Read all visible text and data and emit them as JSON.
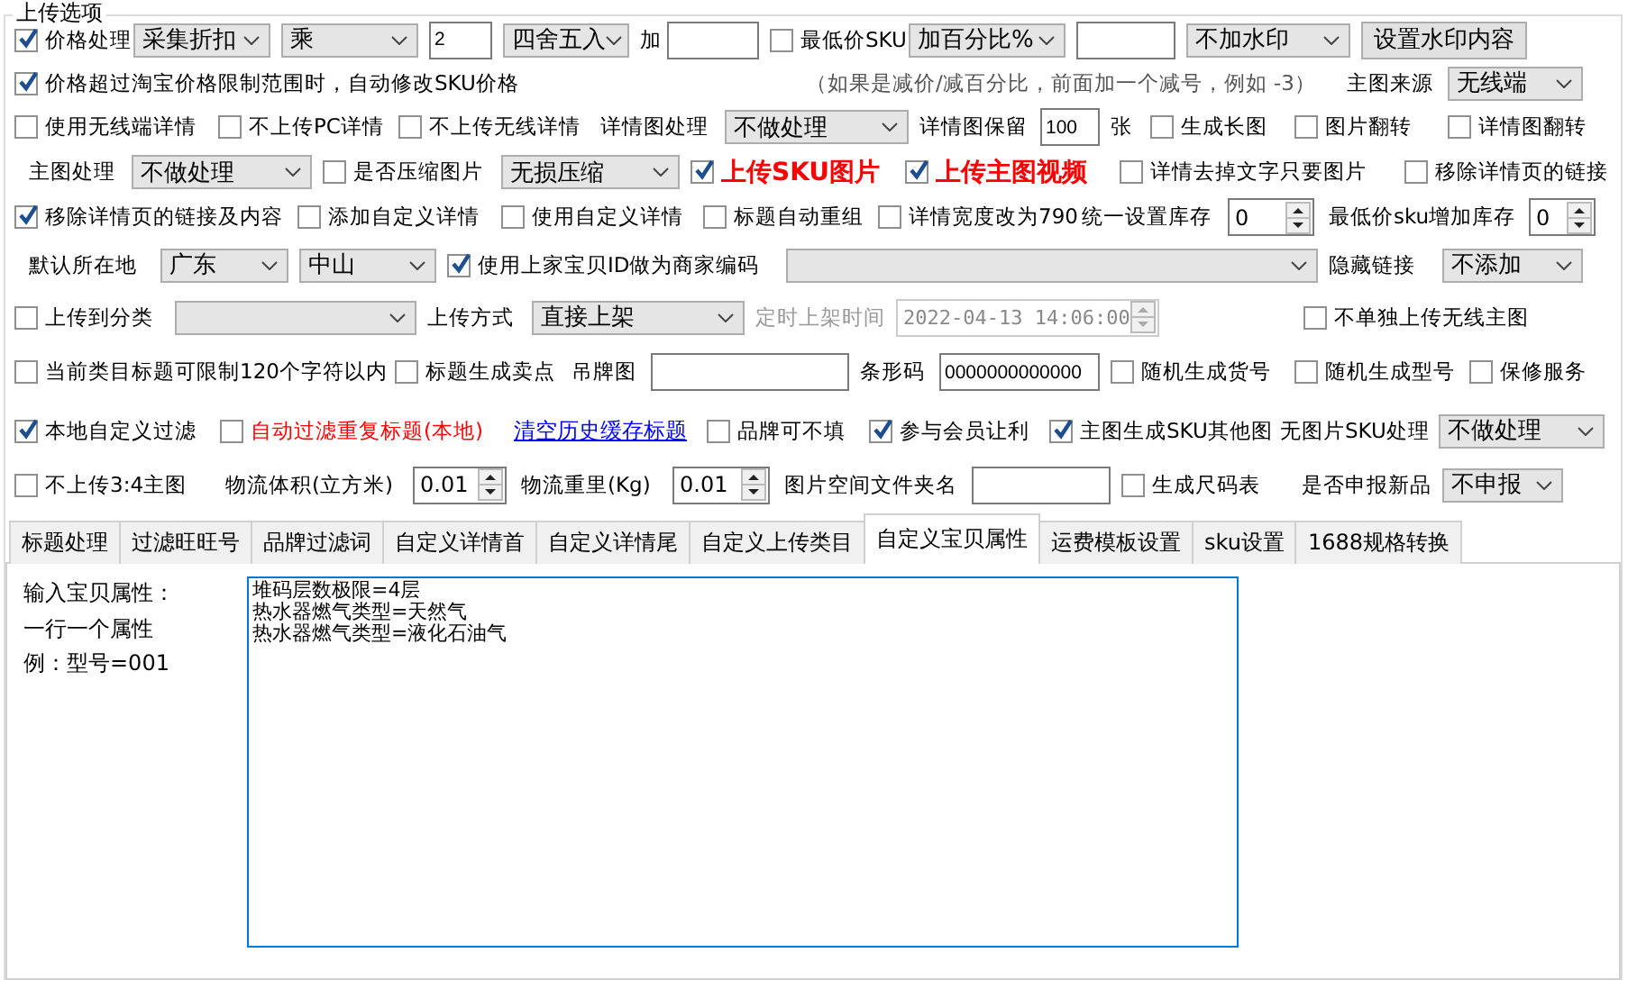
{
  "group_title": "上传选项",
  "option_rows": [
    [
      {
        "kind": "check",
        "label": "价格处理",
        "checked": true
      },
      {
        "kind": "select",
        "value": "采集折扣"
      },
      {
        "kind": "select",
        "value": "乘"
      },
      {
        "kind": "input",
        "value": "2"
      },
      {
        "kind": "select",
        "value": "四舍五入"
      },
      {
        "kind": "label",
        "text": "加"
      },
      {
        "kind": "input"
      },
      {
        "kind": "check",
        "label": "最低价SKU",
        "checked": false
      },
      {
        "kind": "select",
        "value": "加百分比%"
      },
      {
        "kind": "input"
      },
      {
        "kind": "select",
        "value": "不加水印"
      },
      {
        "kind": "button",
        "text": "设置水印内容"
      }
    ],
    [
      {
        "kind": "check",
        "label": "价格超过淘宝价格限制范围时，自动修改SKU价格",
        "checked": true
      },
      {
        "kind": "note",
        "text": "（如果是减价/减百分比，前面加一个减号，例如 -3）"
      },
      {
        "kind": "label",
        "text": "主图来源"
      },
      {
        "kind": "select",
        "value": "无线端"
      }
    ],
    [
      {
        "kind": "check",
        "label": "使用无线端详情",
        "checked": false
      },
      {
        "kind": "check",
        "label": "不上传PC详情",
        "checked": false
      },
      {
        "kind": "check",
        "label": "不上传无线详情",
        "checked": false
      },
      {
        "kind": "label",
        "text": "详情图处理"
      },
      {
        "kind": "select",
        "value": "不做处理"
      },
      {
        "kind": "label",
        "text": "详情图保留"
      },
      {
        "kind": "input",
        "value": "100"
      },
      {
        "kind": "label",
        "text": "张"
      },
      {
        "kind": "check",
        "label": "生成长图",
        "checked": false
      },
      {
        "kind": "check",
        "label": "图片翻转",
        "checked": false
      },
      {
        "kind": "check",
        "label": "详情图翻转",
        "checked": false
      }
    ],
    [
      {
        "kind": "label",
        "text": "主图处理"
      },
      {
        "kind": "select",
        "value": "不做处理"
      },
      {
        "kind": "check",
        "label": "是否压缩图片",
        "checked": false
      },
      {
        "kind": "select",
        "value": "无损压缩"
      },
      {
        "kind": "check",
        "label": "上传SKU图片",
        "checked": true,
        "color": "#ff0000",
        "bold": true
      },
      {
        "kind": "check",
        "label": "上传主图视频",
        "checked": true,
        "color": "#ff0000",
        "bold": true
      },
      {
        "kind": "check",
        "label": "详情去掉文字只要图片",
        "checked": false
      },
      {
        "kind": "check",
        "label": "移除详情页的链接",
        "checked": false
      }
    ],
    [
      {
        "kind": "check",
        "label": "移除详情页的链接及内容",
        "checked": true
      },
      {
        "kind": "check",
        "label": "添加自定义详情",
        "checked": false
      },
      {
        "kind": "check",
        "label": "使用自定义详情",
        "checked": false
      },
      {
        "kind": "check",
        "label": "标题自动重组",
        "checked": false
      },
      {
        "kind": "check",
        "label": "详情宽度改为790",
        "checked": false
      },
      {
        "kind": "label",
        "text": "统一设置库存"
      },
      {
        "kind": "spin",
        "value": "0"
      },
      {
        "kind": "label",
        "text": "最低价sku增加库存"
      },
      {
        "kind": "spin",
        "value": "0"
      }
    ],
    [
      {
        "kind": "label",
        "text": "默认所在地"
      },
      {
        "kind": "select",
        "value": "广东"
      },
      {
        "kind": "select",
        "value": "中山"
      },
      {
        "kind": "check",
        "label": "使用上家宝贝ID做为商家编码",
        "checked": true
      },
      {
        "kind": "select"
      },
      {
        "kind": "label",
        "text": "隐藏链接"
      },
      {
        "kind": "select",
        "value": "不添加"
      }
    ],
    [
      {
        "kind": "check",
        "label": "上传到分类",
        "checked": false
      },
      {
        "kind": "select"
      },
      {
        "kind": "label",
        "text": "上传方式"
      },
      {
        "kind": "select",
        "value": "直接上架"
      },
      {
        "kind": "label",
        "text": "定时上架时间",
        "disabled": true
      },
      {
        "kind": "spin",
        "value": "2022-04-13 14:06:00",
        "disabled": true
      },
      {
        "kind": "check",
        "label": "不单独上传无线主图",
        "checked": false
      }
    ],
    [
      {
        "kind": "check",
        "label": "当前类目标题可限制120个字符以内",
        "checked": false
      },
      {
        "kind": "check",
        "label": "标题生成卖点",
        "checked": false
      },
      {
        "kind": "label",
        "text": "吊牌图"
      },
      {
        "kind": "input"
      },
      {
        "kind": "label",
        "text": "条形码"
      },
      {
        "kind": "input",
        "value": "0000000000000"
      },
      {
        "kind": "check",
        "label": "随机生成货号",
        "checked": false
      },
      {
        "kind": "check",
        "label": "随机生成型号",
        "checked": false
      },
      {
        "kind": "check",
        "label": "保修服务",
        "checked": false
      }
    ],
    [
      {
        "kind": "check",
        "label": "本地自定义过滤",
        "checked": true
      },
      {
        "kind": "check",
        "label": "自动过滤重复标题(本地)",
        "checked": false,
        "color": "#ff0000"
      },
      {
        "kind": "link",
        "text": "清空历史缓存标题"
      },
      {
        "kind": "check",
        "label": "品牌可不填",
        "checked": false
      },
      {
        "kind": "check",
        "label": "参与会员让利",
        "checked": true
      },
      {
        "kind": "check",
        "label": "主图生成SKU其他图",
        "checked": true
      },
      {
        "kind": "label",
        "text": "无图片SKU处理"
      },
      {
        "kind": "select",
        "value": "不做处理"
      }
    ],
    [
      {
        "kind": "check",
        "label": "不上传3:4主图",
        "checked": false
      },
      {
        "kind": "label",
        "text": "物流体积(立方米)"
      },
      {
        "kind": "spin",
        "value": "0.01"
      },
      {
        "kind": "label",
        "text": "物流重里(Kg)"
      },
      {
        "kind": "spin",
        "value": "0.01"
      },
      {
        "kind": "label",
        "text": "图片空间文件夹名"
      },
      {
        "kind": "input"
      },
      {
        "kind": "check",
        "label": "生成尺码表",
        "checked": false
      },
      {
        "kind": "label",
        "text": "是否申报新品"
      },
      {
        "kind": "select",
        "value": "不申报"
      }
    ]
  ],
  "tabs": [
    {
      "label": "标题处理",
      "selected": false
    },
    {
      "label": "过滤旺旺号",
      "selected": false
    },
    {
      "label": "品牌过滤词",
      "selected": false
    },
    {
      "label": "自定义详情首",
      "selected": false
    },
    {
      "label": "自定义详情尾",
      "selected": false
    },
    {
      "label": "自定义上传类目",
      "selected": false
    },
    {
      "label": "自定义宝贝属性",
      "selected": true
    },
    {
      "label": "运费模板设置",
      "selected": false
    },
    {
      "label": "sku设置",
      "selected": false
    },
    {
      "label": "1688规格转换",
      "selected": false
    }
  ],
  "tab_panel": {
    "hints": [
      "输入宝贝属性：",
      "一行一个属性",
      "例：型号=001"
    ],
    "attribute_lines": [
      "堆码层数极限=4层",
      "热水器燃气类型=天然气",
      "热水器燃气类型=液化石油气"
    ]
  }
}
